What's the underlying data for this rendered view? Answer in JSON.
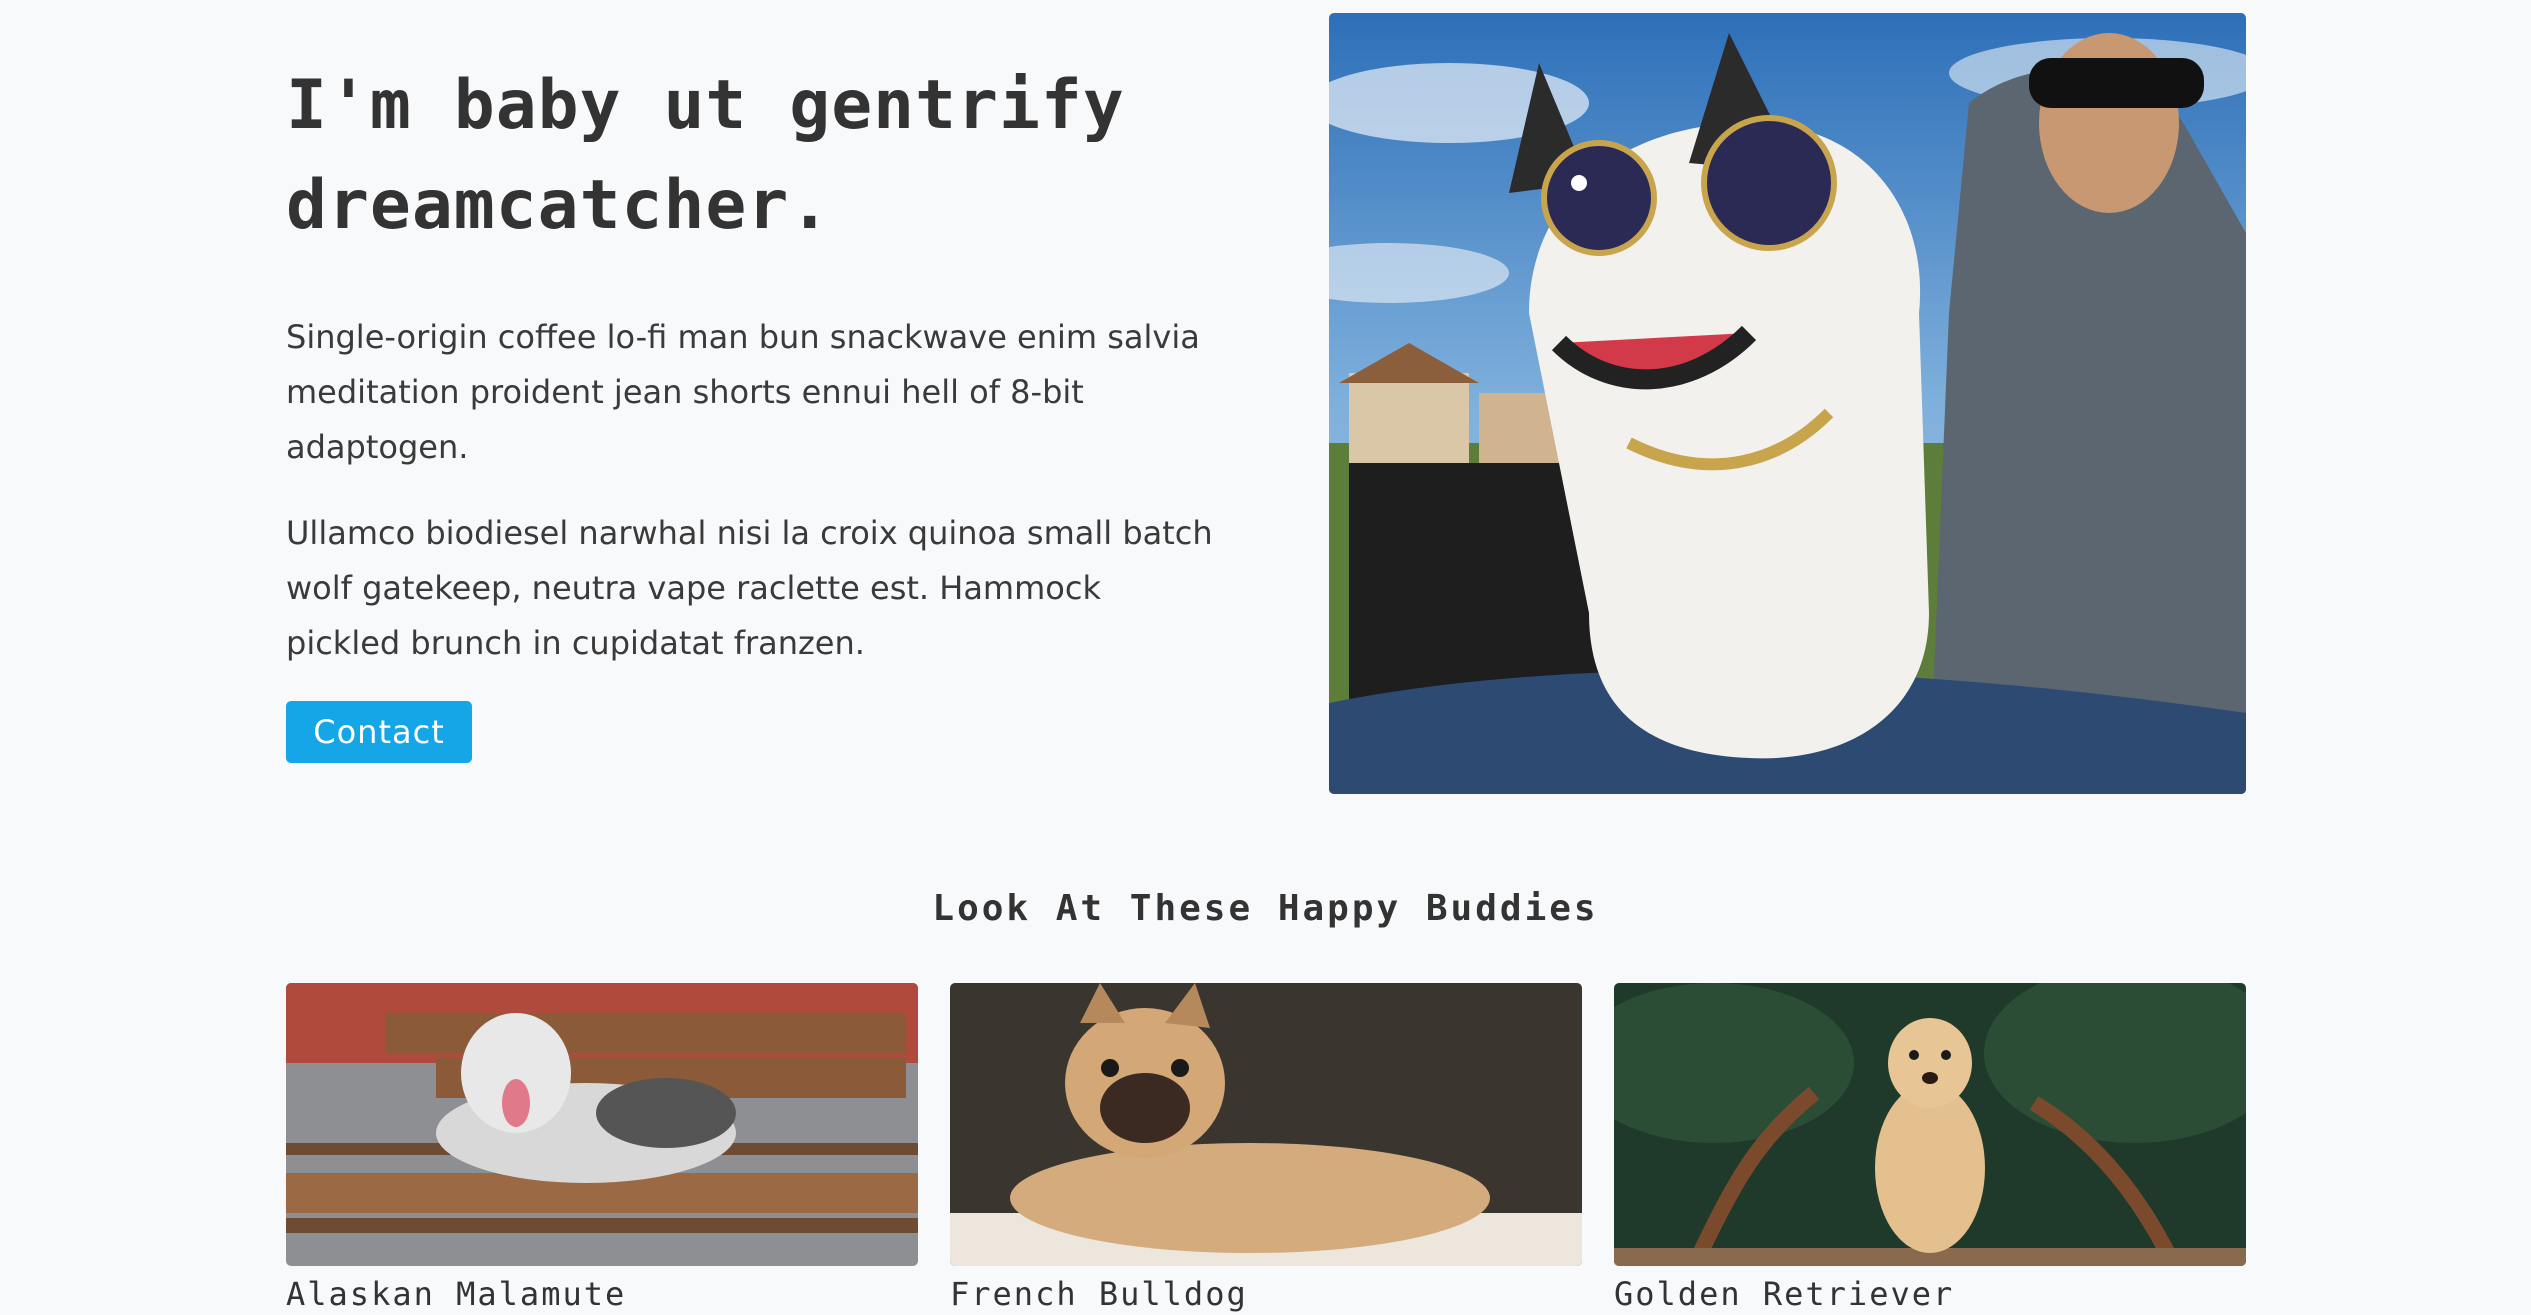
{
  "hero": {
    "title": "I'm baby ut gentrify dreamcatcher.",
    "paragraph_1": "Single-origin coffee lo-fi man bun snackwave enim salvia meditation proident jean shorts ennui hell of 8-bit adaptogen.",
    "paragraph_2": "Ullamco biodiesel narwhal nisi la croix quinoa small batch wolf gatekeep, neutra vape raclette est. Hammock pickled brunch in cupidatat franzen.",
    "contact_label": "Contact"
  },
  "gallery": {
    "title": "Look At These Happy Buddies",
    "cards": [
      {
        "name": "Alaskan Malamute"
      },
      {
        "name": "French Bulldog"
      },
      {
        "name": "Golden Retriever"
      }
    ]
  },
  "colors": {
    "background": "#f8f9fb",
    "accent": "#14a6e6",
    "text": "#333333"
  }
}
